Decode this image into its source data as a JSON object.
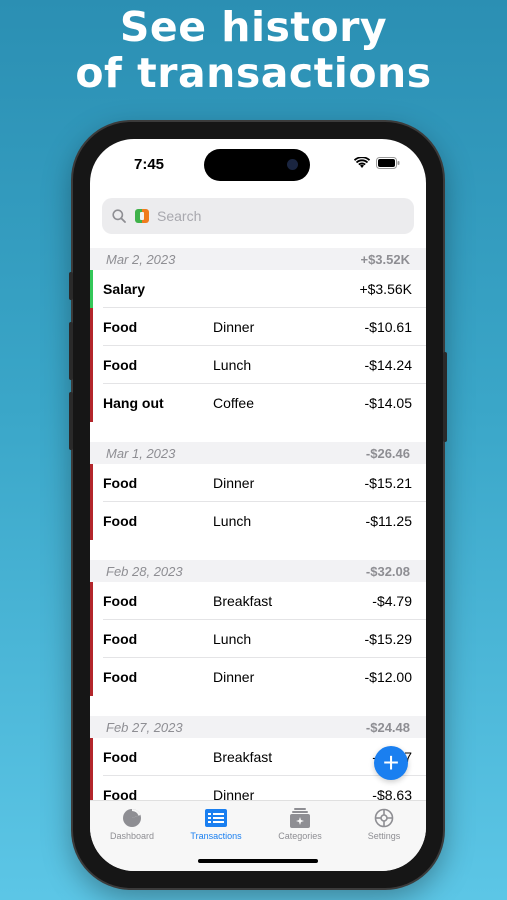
{
  "headline": {
    "line1": "See history",
    "line2": "of transactions"
  },
  "status_bar": {
    "time": "7:45"
  },
  "search": {
    "placeholder": "Search",
    "value": ""
  },
  "groups": [
    {
      "date": "Mar 2, 2023",
      "total": "+$3.52K",
      "color_positive": "#34c759",
      "rows": [
        {
          "category": "Salary",
          "note": "",
          "amount": "+$3.56K",
          "bar": "#34c759"
        },
        {
          "category": "Food",
          "note": "Dinner",
          "amount": "-$10.61",
          "bar": "#b3262b"
        },
        {
          "category": "Food",
          "note": "Lunch",
          "amount": "-$14.24",
          "bar": "#b3262b"
        },
        {
          "category": "Hang out",
          "note": "Coffee",
          "amount": "-$14.05",
          "bar": "#b3262b"
        }
      ]
    },
    {
      "date": "Mar 1, 2023",
      "total": "-$26.46",
      "rows": [
        {
          "category": "Food",
          "note": "Dinner",
          "amount": "-$15.21",
          "bar": "#b3262b"
        },
        {
          "category": "Food",
          "note": "Lunch",
          "amount": "-$11.25",
          "bar": "#b3262b"
        }
      ]
    },
    {
      "date": "Feb 28, 2023",
      "total": "-$32.08",
      "rows": [
        {
          "category": "Food",
          "note": "Breakfast",
          "amount": "-$4.79",
          "bar": "#b3262b"
        },
        {
          "category": "Food",
          "note": "Lunch",
          "amount": "-$15.29",
          "bar": "#b3262b"
        },
        {
          "category": "Food",
          "note": "Dinner",
          "amount": "-$12.00",
          "bar": "#b3262b"
        }
      ]
    },
    {
      "date": "Feb 27, 2023",
      "total": "-$24.48",
      "rows": [
        {
          "category": "Food",
          "note": "Breakfast",
          "amount": "-$3.57",
          "bar": "#b3262b"
        },
        {
          "category": "Food",
          "note": "Dinner",
          "amount": "-$8.63",
          "bar": "#b3262b"
        }
      ]
    }
  ],
  "fab": {
    "label": "+"
  },
  "tabs": [
    {
      "label": "Dashboard",
      "icon": "pie-chart-icon",
      "active": false
    },
    {
      "label": "Transactions",
      "icon": "list-icon",
      "active": true
    },
    {
      "label": "Categories",
      "icon": "categories-icon",
      "active": false
    },
    {
      "label": "Settings",
      "icon": "gear-icon",
      "active": false
    }
  ],
  "colors": {
    "accent": "#1a7ff0",
    "expense": "#b3262b",
    "income": "#34c759"
  }
}
